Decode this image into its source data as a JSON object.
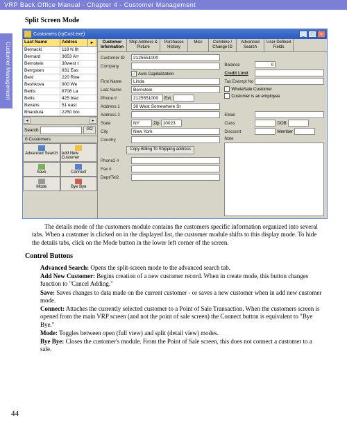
{
  "header": "VRP Back Office Manual - Chapter 4 - Customer Management",
  "sidetab": "Customer Management",
  "section1": "Split Screen Mode",
  "section2": "Control Buttons",
  "pagenum": "44",
  "window": {
    "title": "Customers (rpCust.exe)",
    "list": {
      "cols": {
        "lastname": "Last Name",
        "address": "Addres"
      },
      "rows": [
        {
          "ln": "Bernacki",
          "ad": "118 N 8t"
        },
        {
          "ln": "Bernard",
          "ad": "3653 Arr"
        },
        {
          "ln": "Bernstein",
          "ad": "30west t"
        },
        {
          "ln": "Berrgsten",
          "ad": "931 Eas"
        },
        {
          "ln": "Berti",
          "ad": "220 Rive"
        },
        {
          "ln": "Beshkova",
          "ad": "900 We"
        },
        {
          "ln": "Bettis",
          "ad": "8708 La"
        },
        {
          "ln": "Betts",
          "ad": "425 blac"
        },
        {
          "ln": "Bevans",
          "ad": "51 east"
        },
        {
          "ln": "Bhandula",
          "ad": "2250 bro"
        }
      ],
      "search_label": "Search",
      "go": "GO",
      "count": "0 Customers"
    },
    "buttons": {
      "adv": "Advanced Search",
      "add": "Add New Customer",
      "save": "Save",
      "connect": "Connect",
      "mode": "Mode",
      "bye": "Bye Bye"
    },
    "tabs": [
      "Customer Information",
      "Ship Address & Picture",
      "Purchases History",
      "Misc",
      "Combine / Change ID",
      "Advanced Search",
      "User Defined Fields"
    ],
    "form": {
      "customer_id_l": "Customer ID",
      "customer_id": "2125551000",
      "company_l": "Company",
      "autocap": "Auto Capitalization",
      "firstname_l": "First Name",
      "firstname": "Linda",
      "lastname_l": "Last Name",
      "lastname": "Bernstein",
      "phone_l": "Phone #",
      "phone": "2125551000",
      "ext_l": "Ext.",
      "addr1_l": "Address 1",
      "addr1": "30 West Somewhere St",
      "addr2_l": "Address 2",
      "state_l": "State",
      "state": "NY",
      "zip_l": "Zip",
      "zip": "10023",
      "city_l": "City",
      "city": "New York",
      "country_l": "Country",
      "copybtn": "Copy Billing To Shipping address",
      "phone2_l": "Phone2 #",
      "fax_l": "Fax #",
      "dept_l": "Dept/Tel2",
      "balance_l": "Balance",
      "balance": "0",
      "credit_l": "Credit Limit",
      "taxex_l": "Tax Exempt No",
      "wholesale": "WholeSale Customer",
      "employee": "Customer is an employee",
      "email_l": "EMail",
      "class_l": "Class",
      "dob_l": "DOB",
      "discount_l": "Discount",
      "member_l": "Member",
      "note_l": "Note"
    }
  },
  "para1": "The details mode of the customers module contains the customers specific information organized into several tabs.  When a customer is clicked on in the displayed list, the customer module shifts to this display mode.  To hide the details tabs, click on the Mode button in the lower left corner of the screen.",
  "defs": {
    "adv_t": "Advanced Search:",
    "adv": " Opens the split-screen mode to the advanced search tab.",
    "add_t": "Add New Customer:",
    "add": " Begins creation of a new customer record.  When in create mode, this button changes function to \"Cancel Adding.\"",
    "save_t": "Save:",
    "save": " Saves changes to data made on the current customer - or saves a new customer when in add new customer mode.",
    "connect_t": "Connect:",
    "connect": " Attaches the currently selected customer to a Point of Sale Transaction.  When the customers screen is opened from the main VRP screen (and not the point of sale screen) the Connect button is equivalent to \"Bye Bye.\"",
    "mode_t": "Mode:",
    "mode": " Toggles between open (full view) and split (detail view) modes.",
    "bye_t": "Bye Bye:",
    "bye": " Closes the customer's module.  From the Point of Sale screen, this does not connect a customer to a sale."
  }
}
